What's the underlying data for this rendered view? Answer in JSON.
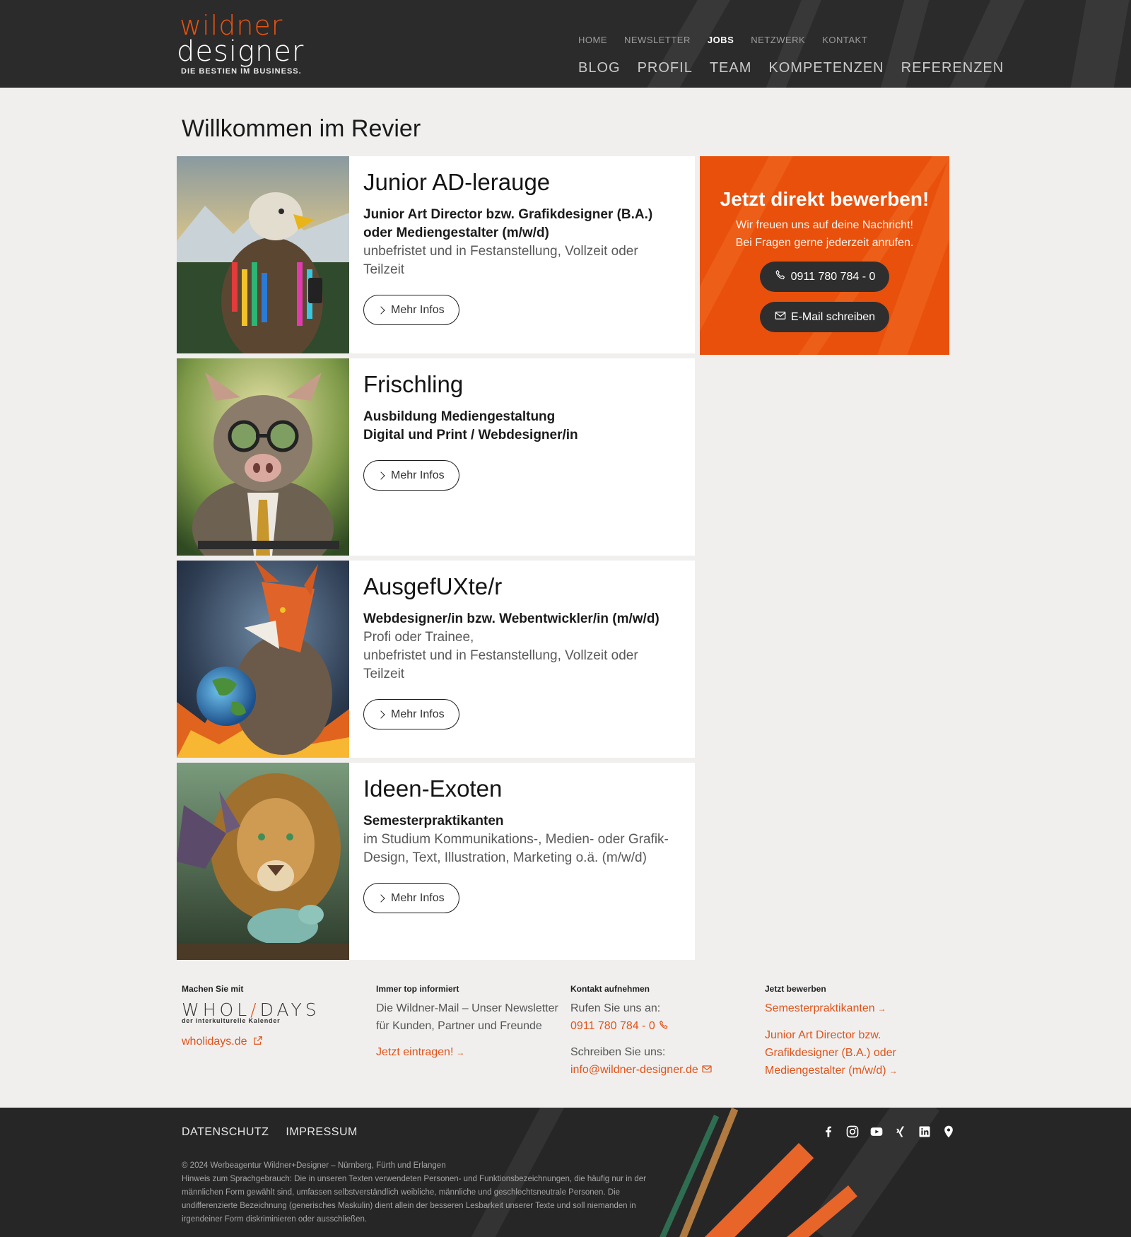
{
  "header": {
    "logo": {
      "line1": "wildner",
      "line2": "designer",
      "tagline": "DIE BESTIEN IM BUSINESS."
    },
    "top_nav": [
      "HOME",
      "NEWSLETTER",
      "JOBS",
      "NETZWERK",
      "KONTAKT"
    ],
    "active_top_nav": "JOBS",
    "main_nav": [
      "BLOG",
      "PROFIL",
      "TEAM",
      "KOMPETENZEN",
      "REFERENZEN"
    ]
  },
  "page": {
    "title": "Willkommen im Revier"
  },
  "jobs": [
    {
      "title": "Junior AD-lerauge",
      "subtitle": [
        "Junior Art Director bzw. Grafikdesigner (B.A.) oder Mediengestalter (m/w/d)"
      ],
      "description": [
        "unbefristet und in Festanstellung, Vollzeit oder Teilzeit"
      ],
      "button": "Mehr Infos",
      "image_icon": "eagle-image"
    },
    {
      "title": "Frischling",
      "subtitle": [
        "Ausbildung Mediengestaltung",
        "Digital und Print / Webdesigner/in"
      ],
      "description": [],
      "button": "Mehr Infos",
      "image_icon": "boar-image"
    },
    {
      "title": "AusgefUXte/r",
      "subtitle": [
        "Webdesigner/in bzw. Webentwickler/in (m/w/d)"
      ],
      "description": [
        "Profi oder Trainee,",
        "unbefristet und in Festanstellung, Vollzeit oder Teilzeit"
      ],
      "button": "Mehr Infos",
      "image_icon": "fox-image"
    },
    {
      "title": "Ideen-Exoten",
      "subtitle": [
        "Semesterpraktikanten"
      ],
      "description": [
        "im Studium Kommunikations-, Medien- oder Grafik-Design, Text, Illustration, Marketing o.ä. (m/w/d)"
      ],
      "button": "Mehr Infos",
      "image_icon": "lion-image"
    }
  ],
  "apply_box": {
    "title": "Jetzt direkt bewerben!",
    "line1": "Wir freuen uns auf deine Nachricht!",
    "line2": "Bei Fragen gerne jederzeit anrufen.",
    "phone_label": "0911 780 784 - 0",
    "email_label": "E-Mail schreiben",
    "background": "#e8500c"
  },
  "footer_info": {
    "col1": {
      "heading": "Machen Sie mit",
      "logo_text_a": "WHOL",
      "logo_text_b": "DAYS",
      "logo_sub": "der interkulturelle Kalender",
      "link": "wholidays.de"
    },
    "col2": {
      "heading": "Immer top informiert",
      "text": "Die Wildner-Mail – Unser Newsletter für Kunden, Partner und Freunde",
      "link": "Jetzt eintragen!"
    },
    "col3": {
      "heading": "Kontakt aufnehmen",
      "call_label": "Rufen Sie uns an:",
      "phone": "0911 780 784 - 0",
      "write_label": "Schreiben Sie uns:",
      "email": "info@wildner-designer.de"
    },
    "col4": {
      "heading": "Jetzt bewerben",
      "link1": "Semesterpraktikanten",
      "link2": "Junior Art Director bzw. Grafikdesigner (B.A.) oder Mediengestalter (m/w/d)"
    }
  },
  "bottom_footer": {
    "links": [
      "DATENSCHUTZ",
      "IMPRESSUM"
    ],
    "social_icons": [
      "facebook-icon",
      "instagram-icon",
      "youtube-icon",
      "xing-icon",
      "linkedin-icon",
      "map-pin-icon"
    ],
    "copyright": "© 2024 Werbeagentur Wildner+Designer – Nürnberg, Fürth und Erlangen",
    "notice": "Hinweis zum Sprachgebrauch: Die in unseren Texten verwendeten Personen- und Funktionsbezeichnungen, die häufig nur in der männlichen Form gewählt sind, umfassen selbstverständlich weibliche, männliche und geschlechtsneutrale Personen. Die undifferenzierte Bezeichnung (generisches Maskulin) dient allein der besseren Lesbarkeit unserer Texte und soll niemanden in irgendeiner Form diskriminieren oder ausschließen."
  },
  "colors": {
    "accent": "#e8530f",
    "header_bg": "#2b2b2b",
    "page_bg": "#f0efee"
  }
}
